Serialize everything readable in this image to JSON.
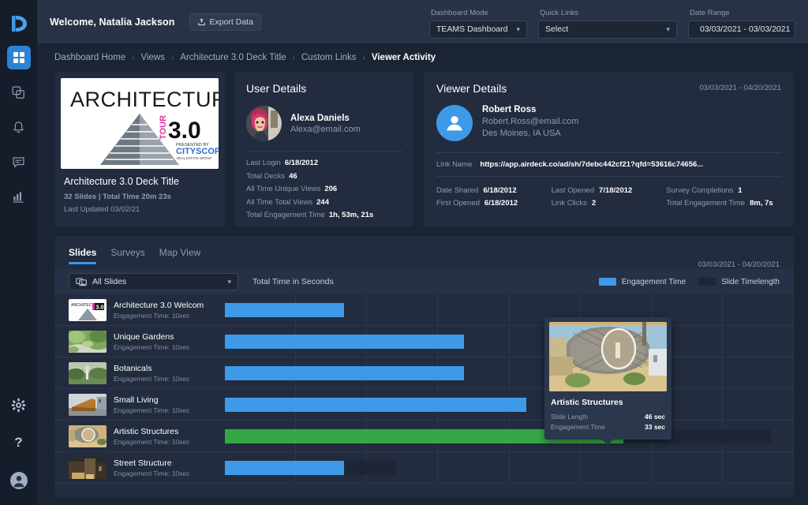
{
  "colors": {
    "accent": "#3d9ae8",
    "highlight_green": "#34a845",
    "panel_bg": "#222c3e",
    "app_bg": "#1b2433",
    "rail_bg": "#151d2b",
    "topbar_bg": "#273246",
    "muted_text": "#8d9bb0"
  },
  "rail": {
    "logo": "airdeck-logo-icon",
    "items": [
      {
        "icon": "grid-dashboard-icon",
        "name": "dashboard",
        "active": true
      },
      {
        "icon": "copy-decks-icon",
        "name": "decks",
        "active": false
      },
      {
        "icon": "bell-notifications-icon",
        "name": "notifications",
        "active": false
      },
      {
        "icon": "chat-messages-icon",
        "name": "messages",
        "active": false
      },
      {
        "icon": "bar-chart-analytics-icon",
        "name": "analytics",
        "active": false
      }
    ],
    "bottom": [
      {
        "icon": "gear-settings-icon",
        "name": "settings"
      },
      {
        "icon": "question-help-icon",
        "name": "help"
      },
      {
        "icon": "user-account-icon",
        "name": "account"
      }
    ]
  },
  "header": {
    "welcome": "Welcome, Natalia Jackson",
    "export_label": "Export Data",
    "export_icon": "upload-export-icon",
    "controls": [
      {
        "label": "Dashboard Mode",
        "value": "TEAMS Dashboard",
        "icon": "",
        "caret": "chevron-down-icon"
      },
      {
        "label": "Quick Links",
        "value": "Select",
        "icon": "",
        "caret": "chevron-down-icon"
      },
      {
        "label": "Date Range",
        "value": "03/03/2021 - 03/03/2021",
        "icon": "calendar-icon",
        "caret": ""
      }
    ]
  },
  "breadcrumb": {
    "separator": "›",
    "items": [
      {
        "label": "Dashboard Home",
        "current": false
      },
      {
        "label": "Views",
        "current": false
      },
      {
        "label": "Architecture 3.0 Deck Title",
        "current": false
      },
      {
        "label": "Custom Links",
        "current": false
      },
      {
        "label": "Viewer Activity",
        "current": true
      }
    ]
  },
  "deck_card": {
    "thumb_title": "ARCHITECTURE",
    "thumb_tour": "TOUR",
    "thumb_version": "3.0",
    "thumb_presented": "PRESENTED BY",
    "thumb_brand": "CITYSCOPE",
    "thumb_brand_sub": "REAL ESTATE GROUP",
    "title": "Architecture 3.0 Deck Title",
    "stats": "32 Slides | Total Time 20m 23s",
    "updated": "Last Updated 03/02/21"
  },
  "user_details": {
    "title": "User Details",
    "avatar": "avatar-photo",
    "name": "Alexa Daniels",
    "email": "Alexa@email.com",
    "stats": [
      {
        "key": "Last Login",
        "value": "6/18/2012"
      },
      {
        "key": "Total Decks",
        "value": "46"
      },
      {
        "key": "All Time Unique Views",
        "value": "206"
      },
      {
        "key": "All Time Total Views",
        "value": "244"
      },
      {
        "key": "Total Engagement Time",
        "value": "1h, 53m, 21s"
      }
    ]
  },
  "viewer_details": {
    "title": "Viewer Details",
    "date_range": "03/03/2021 - 04/20/2021",
    "avatar_icon": "person-avatar-icon",
    "name": "Robert Ross",
    "email": "Robert.Ross@email.com",
    "location": "Des Moines, IA  USA",
    "link_label": "Link Name",
    "link_value": "https://app.airdeck.co/ad/sh/7debc442cf21?qfd=53616c74656...",
    "stats": [
      [
        {
          "key": "Date Shared",
          "value": "6/18/2012"
        },
        {
          "key": "First Opened",
          "value": "6/18/2012"
        }
      ],
      [
        {
          "key": "Last Opened",
          "value": "7/18/2012"
        },
        {
          "key": "Link Clicks",
          "value": "2"
        }
      ],
      [
        {
          "key": "Survey Completions",
          "value": "1"
        },
        {
          "key": "Total Engagement Time",
          "value": "8m, 7s"
        }
      ]
    ]
  },
  "panel": {
    "tabs": [
      {
        "label": "Slides",
        "active": true
      },
      {
        "label": "Surveys",
        "active": false
      },
      {
        "label": "Map View",
        "active": false
      }
    ],
    "date_range": "03/03/2021 - 04/20/2021",
    "slides_filter": {
      "label": "All Slides",
      "icon": "slides-stack-icon",
      "caret": "chevron-down-icon"
    },
    "axis_label": "Total Time in Seconds",
    "legend": [
      {
        "label": "Engagement Time",
        "color": "#3d9ae8"
      },
      {
        "label": "Slide Timelength",
        "color": "#1e2635"
      }
    ]
  },
  "chart_data": {
    "type": "bar",
    "title": "Total Time in Seconds",
    "xlabel": "Total Time in Seconds",
    "ylabel": "",
    "orientation": "horizontal",
    "grid": true,
    "legend_position": "top-right",
    "xlim": [
      0,
      100
    ],
    "gridline_count": 8,
    "categories": [
      "Architecture 3.0 Welcom",
      "Unique Gardens",
      "Botanicals",
      "Small Living",
      "Artistic Structures",
      "Street Structure"
    ],
    "row_sublabels": [
      "Engagement Time: 10sec",
      "Engagement Time: 10sec",
      "Engagement Time: 10sec",
      "Engagement Time: 10sec",
      "Engagement Time: 10sec",
      "Engagement Time: 10sec"
    ],
    "series": [
      {
        "name": "Engagement Time",
        "color": "#3d9ae8",
        "values": [
          21,
          42,
          42,
          53,
          70,
          21
        ]
      },
      {
        "name": "Slide Timelength",
        "color": "#1e2635",
        "values": [
          21,
          42,
          42,
          53,
          96,
          30
        ]
      }
    ],
    "highlighted_index": 4,
    "highlight_color": "#34a845"
  },
  "tooltip": {
    "title": "Artistic Structures",
    "rows": [
      {
        "key": "Slide Length",
        "value": "46 sec"
      },
      {
        "key": "Engagement Time",
        "value": "33 sec"
      }
    ]
  }
}
